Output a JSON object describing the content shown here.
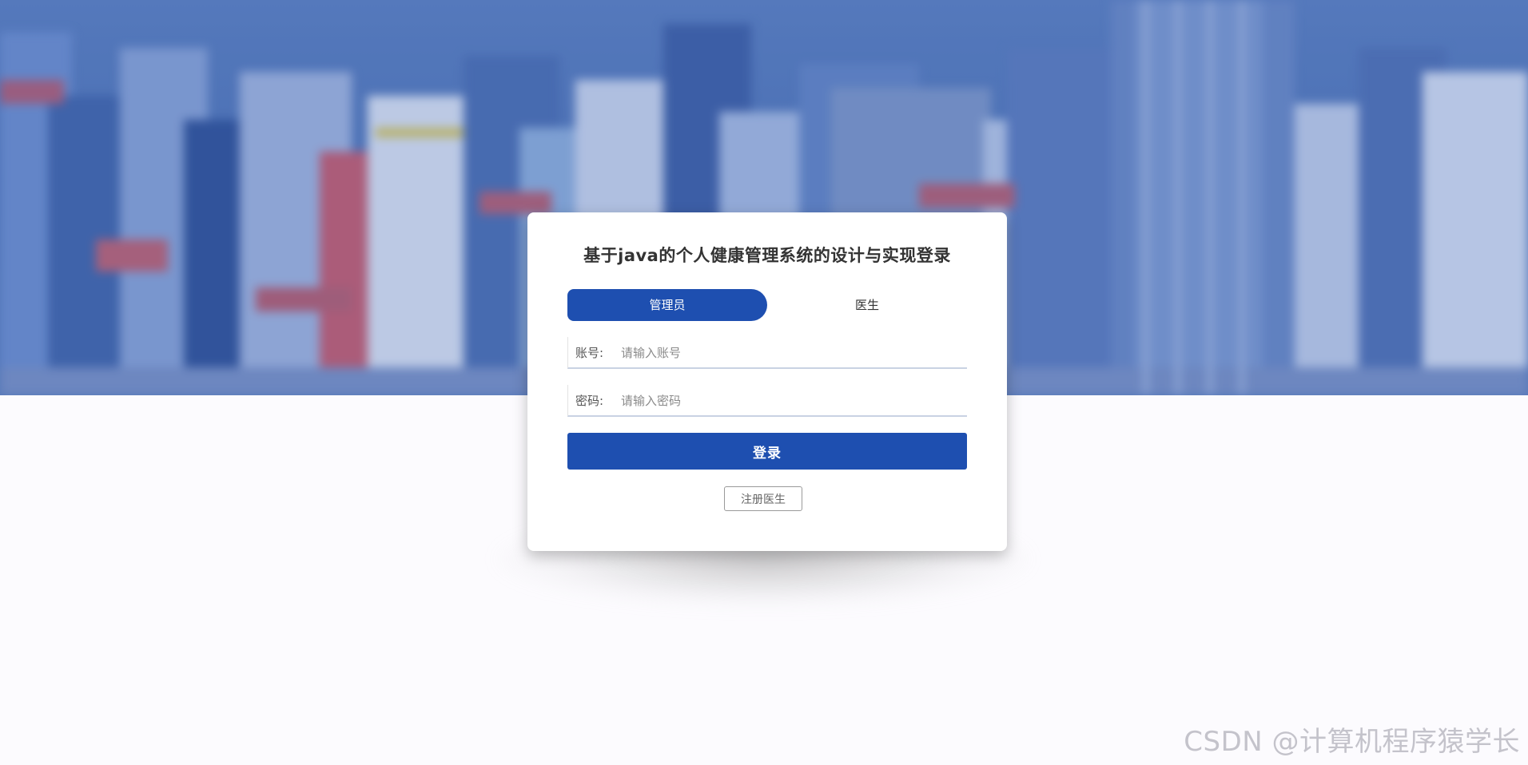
{
  "login": {
    "title": "基于java的个人健康管理系统的设计与实现登录",
    "roles": [
      {
        "label": "管理员",
        "active": true
      },
      {
        "label": "医生",
        "active": false
      }
    ],
    "account": {
      "label": "账号:",
      "placeholder": "请输入账号",
      "value": ""
    },
    "password": {
      "label": "密码:",
      "placeholder": "请输入密码",
      "value": ""
    },
    "login_button": "登录",
    "register_button": "注册医生"
  },
  "watermark": "CSDN @计算机程序猿学长",
  "colors": {
    "primary": "#1e4fb0",
    "background": "#fcfbfe",
    "hero_tint": "#5577b8"
  }
}
